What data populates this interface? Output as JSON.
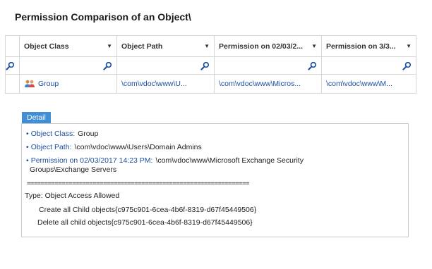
{
  "page": {
    "title": "Permission Comparison of an Object\\"
  },
  "grid": {
    "columns": [
      {
        "label": "Object Class"
      },
      {
        "label": "Object Path"
      },
      {
        "label": "Permission on 02/03/2..."
      },
      {
        "label": "Permission on 3/3..."
      }
    ],
    "row": {
      "object_class": "Group",
      "object_path": "\\com\\vdoc\\www\\U...",
      "perm_1": "\\com\\vdoc\\www\\Micros...",
      "perm_2": "\\com\\vdoc\\www\\M..."
    }
  },
  "detail": {
    "tab_label": "Detail",
    "object_class_key": "Object Class:",
    "object_class_val": "Group",
    "object_path_key": "Object Path:",
    "object_path_val": "\\com\\vdoc\\www\\Users\\Domain Admins",
    "permission_key": "Permission on 02/03/2017 14:23 PM:",
    "permission_val_1": "\\com\\vdoc\\www\\Microsoft Exchange Security",
    "permission_val_2": "Groups\\Exchange Servers",
    "separator": "================================================================",
    "type_line": "Type: Object Access Allowed",
    "entry_1": "Create all Child objects{c975c901-6cea-4b6f-8319-d67f45449506}",
    "entry_2": "Delete all child objects{c975c901-6cea-4b6f-8319-d67f45449506}"
  },
  "colors": {
    "accent": "#3f8ed6",
    "link": "#1c4fa0",
    "border": "#d6d6d6"
  }
}
